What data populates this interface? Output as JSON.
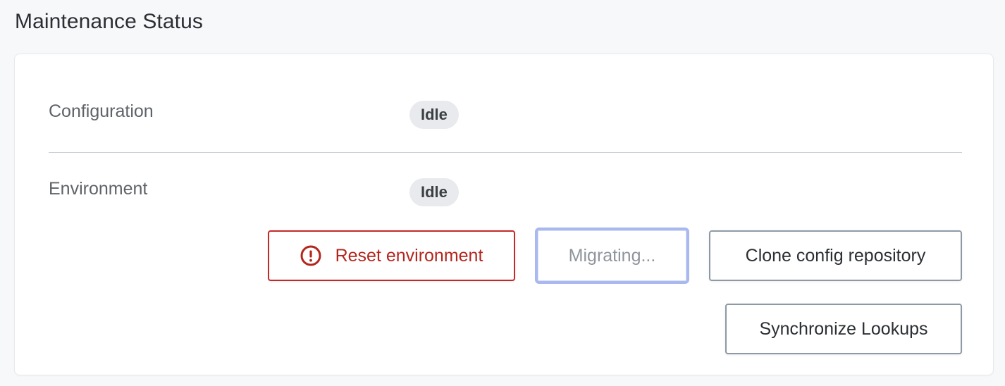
{
  "page": {
    "title": "Maintenance Status"
  },
  "rows": [
    {
      "label": "Configuration",
      "status": "Idle"
    },
    {
      "label": "Environment",
      "status": "Idle"
    }
  ],
  "actions": {
    "reset_label": "Reset environment",
    "migrating_label": "Migrating...",
    "clone_label": "Clone config repository",
    "sync_label": "Synchronize Lookups"
  },
  "icons": {
    "reset": "alert-circle-icon"
  },
  "colors": {
    "danger": "#c62828",
    "badge_bg": "#e8eaed",
    "focus_ring": "#a9b9f0"
  }
}
